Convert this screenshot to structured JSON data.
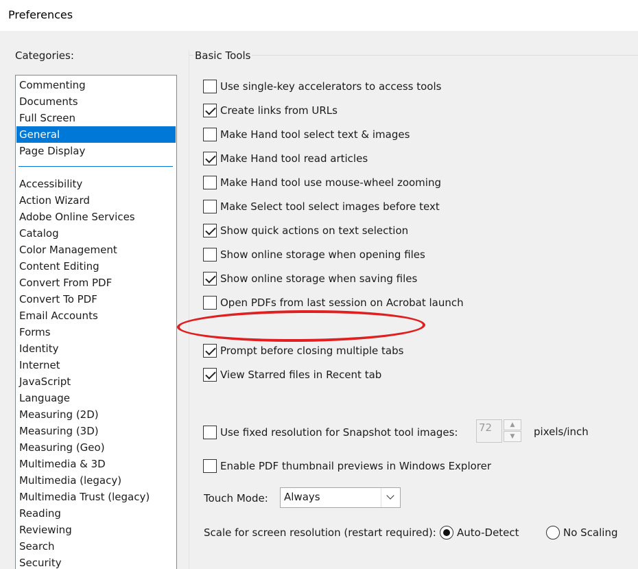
{
  "window": {
    "title": "Preferences"
  },
  "categories": {
    "label": "Categories:",
    "top_items": [
      "Commenting",
      "Documents",
      "Full Screen",
      "General",
      "Page Display"
    ],
    "selected": "General",
    "items": [
      "Accessibility",
      "Action Wizard",
      "Adobe Online Services",
      "Catalog",
      "Color Management",
      "Content Editing",
      "Convert From PDF",
      "Convert To PDF",
      "Email Accounts",
      "Forms",
      "Identity",
      "Internet",
      "JavaScript",
      "Language",
      "Measuring (2D)",
      "Measuring (3D)",
      "Measuring (Geo)",
      "Multimedia & 3D",
      "Multimedia (legacy)",
      "Multimedia Trust (legacy)",
      "Reading",
      "Reviewing",
      "Search",
      "Security"
    ]
  },
  "basic_tools": {
    "title": "Basic Tools",
    "options": [
      {
        "label": "Use single-key accelerators to access tools",
        "checked": false
      },
      {
        "label": "Create links from URLs",
        "checked": true
      },
      {
        "label": "Make Hand tool select text & images",
        "checked": false
      },
      {
        "label": "Make Hand tool read articles",
        "checked": true
      },
      {
        "label": "Make Hand tool use mouse-wheel zooming",
        "checked": false
      },
      {
        "label": "Make Select tool select images before text",
        "checked": false
      },
      {
        "label": "Show quick actions on text selection",
        "checked": true
      },
      {
        "label": "Show online storage when opening files",
        "checked": false
      },
      {
        "label": "Show online storage when saving files",
        "checked": true
      },
      {
        "label": "Open PDFs from last session on Acrobat launch",
        "checked": false
      },
      {
        "label": "Prompt before closing multiple tabs",
        "checked": true
      },
      {
        "label": "View Starred files in Recent tab",
        "checked": true
      }
    ],
    "snapshot": {
      "label": "Use fixed resolution for Snapshot tool images:",
      "checked": false,
      "value": "72",
      "unit": "pixels/inch"
    },
    "thumbnail": {
      "label": "Enable PDF thumbnail previews in Windows Explorer",
      "checked": false
    },
    "touch_mode": {
      "label": "Touch Mode:",
      "value": "Always"
    },
    "scale": {
      "label": "Scale for screen resolution (restart required):",
      "auto": "Auto-Detect",
      "none": "No Scaling",
      "selected": "Auto-Detect"
    }
  },
  "annotation": {
    "color": "#e02020"
  }
}
